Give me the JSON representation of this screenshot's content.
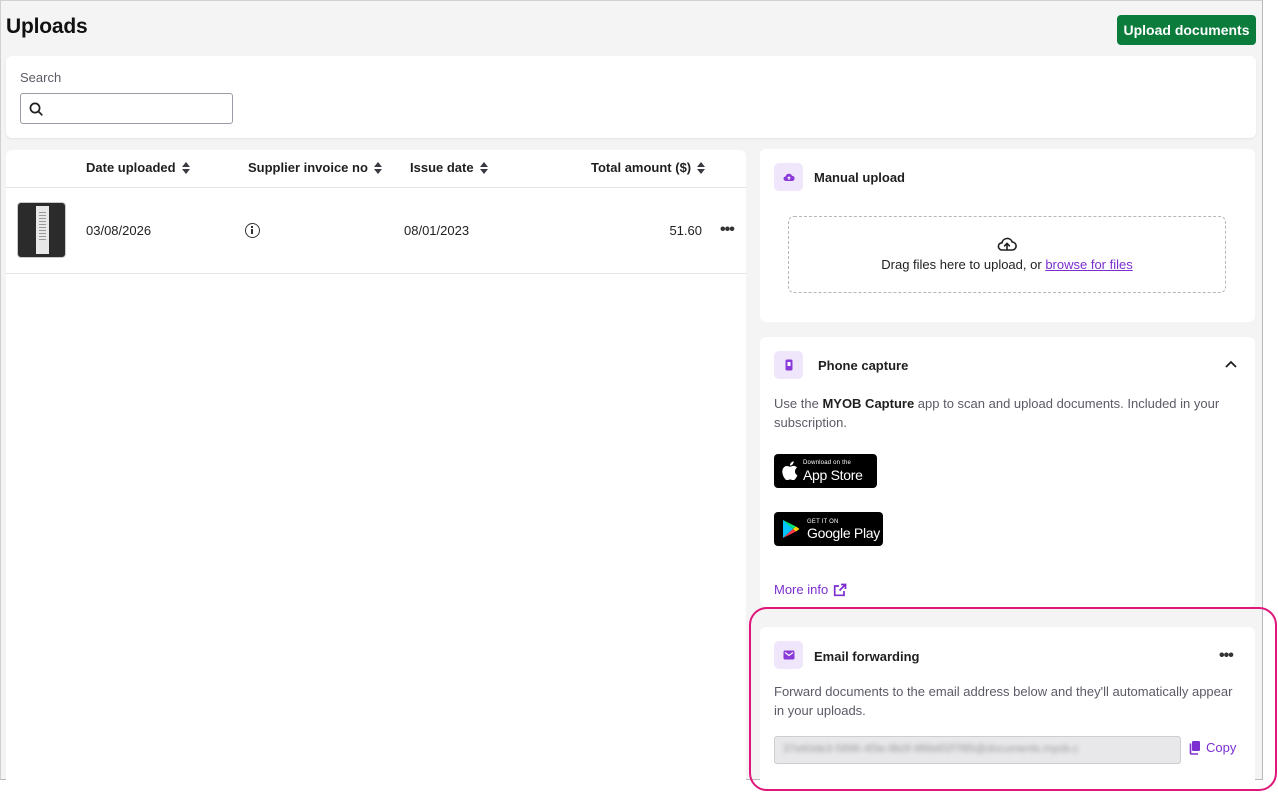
{
  "header": {
    "title": "Uploads",
    "upload_button": "Upload documents"
  },
  "search": {
    "label": "Search",
    "value": "",
    "placeholder": ""
  },
  "table": {
    "columns": [
      "Date uploaded",
      "Supplier invoice no",
      "Issue date",
      "Total amount ($)"
    ],
    "rows": [
      {
        "date_uploaded": "03/08/2026",
        "supplier_invoice_no": "",
        "issue_date": "08/01/2023",
        "total_amount": "51.60"
      }
    ]
  },
  "manual_upload": {
    "title": "Manual upload",
    "drop_text": "Drag files here to upload, or",
    "browse_link": "browse for files"
  },
  "phone_capture": {
    "title": "Phone capture",
    "desc_prefix": "Use the",
    "app_name": "MYOB Capture",
    "desc_suffix": "app to scan and upload documents. Included in your subscription.",
    "app_store_small": "Download on the",
    "app_store_big": "App Store",
    "google_play_small": "GET IT ON",
    "google_play_big": "Google Play",
    "more_info": "More info"
  },
  "email_forwarding": {
    "title": "Email forwarding",
    "desc": "Forward documents to the email address below and they'll automatically appear in your uploads.",
    "email_masked": "37e60de3-5896-4f3e-8b0f-9f6b6f2f7f85@documents.myob.c",
    "copy_label": "Copy"
  },
  "colors": {
    "primary_green": "#0b7c3c",
    "accent_purple": "#7b2fd0",
    "highlight_pink": "#e0177a"
  }
}
